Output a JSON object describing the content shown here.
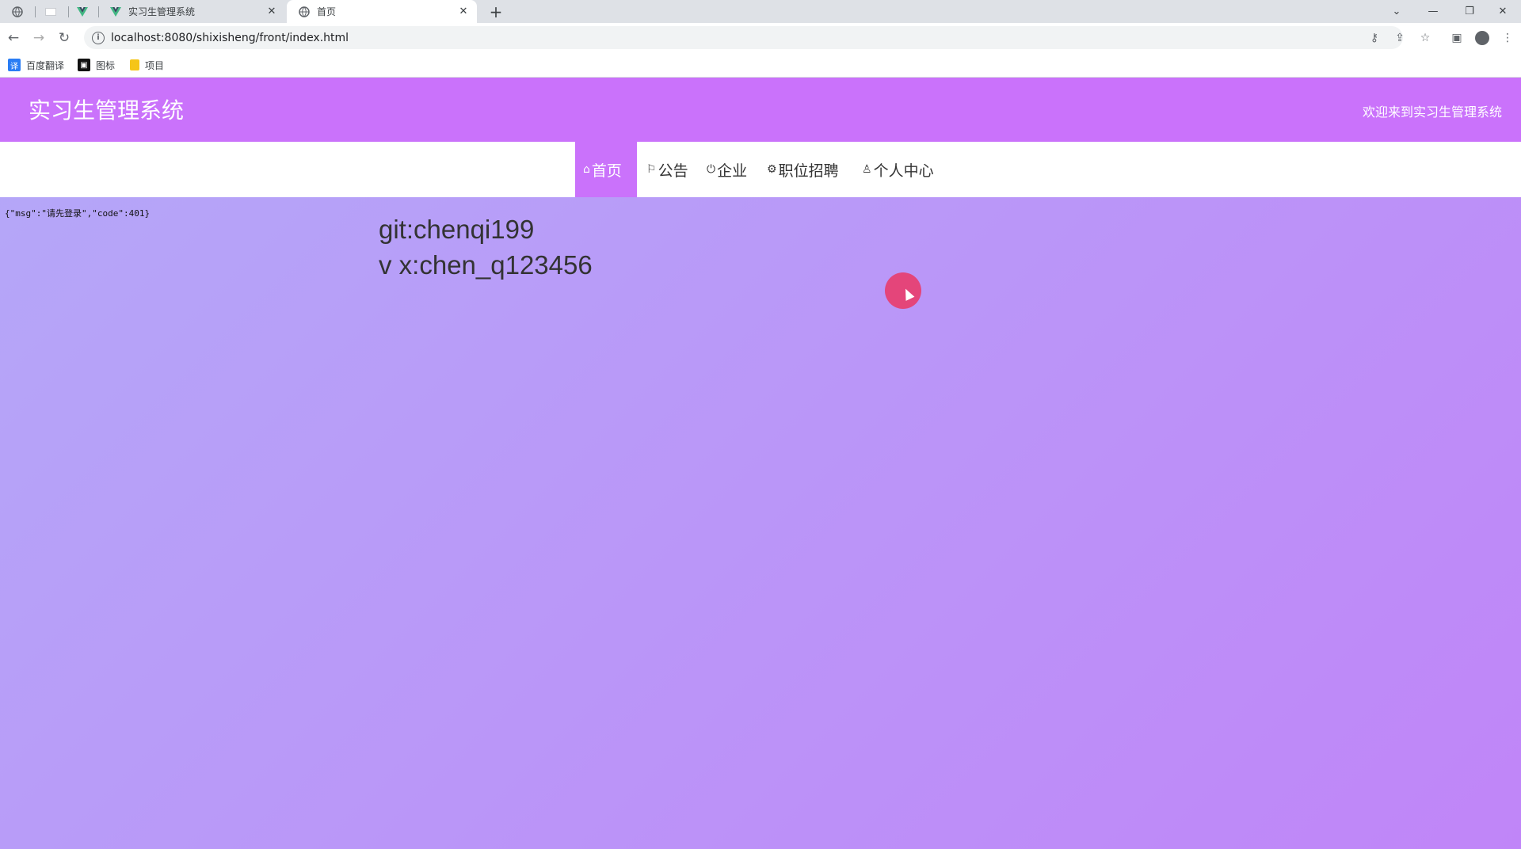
{
  "browser": {
    "tabs": [
      {
        "label": "实习生管理系统",
        "icon": "vue-icon",
        "active": false
      },
      {
        "label": "首页",
        "icon": "globe-icon",
        "active": true
      }
    ],
    "url": "localhost:8080/shixisheng/front/index.html",
    "bookmarks": [
      {
        "label": "百度翻译",
        "icon": "translate-icon"
      },
      {
        "label": "图标",
        "icon": "image-icon"
      },
      {
        "label": "项目",
        "icon": "folder-icon"
      }
    ]
  },
  "site": {
    "title": "实习生管理系统",
    "welcome": "欢迎来到实习生管理系统",
    "accent": "#ca72fb"
  },
  "nav": {
    "items": [
      {
        "label": "首页",
        "icon": "home-icon",
        "glyph": "⌂",
        "active": true
      },
      {
        "label": "公告",
        "icon": "flag-icon",
        "glyph": "⚐",
        "active": false
      },
      {
        "label": "企业",
        "icon": "power-icon",
        "glyph": "⏻",
        "active": false
      },
      {
        "label": "职位招聘",
        "icon": "gear-icon",
        "glyph": "⚙",
        "active": false
      },
      {
        "label": "个人中心",
        "icon": "user-icon",
        "glyph": "♙",
        "active": false
      }
    ]
  },
  "content": {
    "error_message": "{\"msg\":\"请先登录\",\"code\":401}",
    "git_line": "git:chenqi199",
    "wx_line": "v x:chen_q123456"
  }
}
